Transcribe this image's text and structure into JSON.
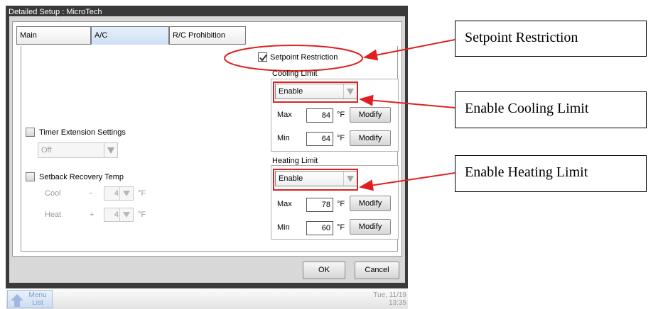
{
  "window": {
    "title": "Detailed Setup : MicroTech"
  },
  "tabs": [
    {
      "label": "Main"
    },
    {
      "label": "A/C"
    },
    {
      "label": "R/C Prohibition"
    }
  ],
  "setpoint_restriction": {
    "label": "Setpoint Restriction",
    "checked": true
  },
  "cooling_limit": {
    "title": "Cooling Limit",
    "mode": "Enable",
    "max_label": "Max",
    "max_value": "84",
    "min_label": "Min",
    "min_value": "64",
    "unit": "°F",
    "modify_label": "Modify"
  },
  "heating_limit": {
    "title": "Heating Limit",
    "mode": "Enable",
    "max_label": "Max",
    "max_value": "78",
    "min_label": "Min",
    "min_value": "60",
    "unit": "°F",
    "modify_label": "Modify"
  },
  "timer_extension": {
    "label": "Timer Extension Settings",
    "value": "Off"
  },
  "setback_recovery": {
    "label": "Setback Recovery Temp",
    "cool_label": "Cool",
    "cool_sign": "-",
    "cool_value": "4",
    "heat_label": "Heat",
    "heat_sign": "+",
    "heat_value": "4",
    "unit": "°F"
  },
  "footer": {
    "ok_label": "OK",
    "cancel_label": "Cancel"
  },
  "taskbar": {
    "menu_line1": "Menu",
    "menu_line2": "List",
    "date": "Tue, 11/19",
    "time": "13:35"
  },
  "annotations": {
    "setpoint": "Setpoint Restriction",
    "cooling": "Enable Cooling Limit",
    "heating": "Enable Heating Limit"
  },
  "colors": {
    "annotation_red": "#e02020",
    "tab_active": "#cfe0f5",
    "window_frame": "#3a3a3a"
  }
}
